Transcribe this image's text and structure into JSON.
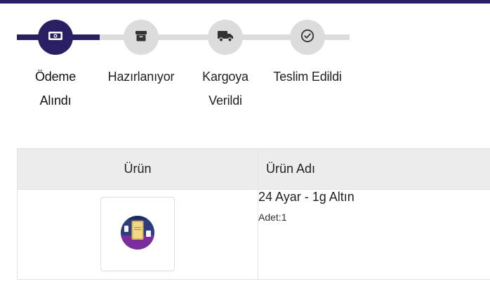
{
  "stepper": {
    "progress_fraction": 0.25,
    "active_color": "#2b1f63",
    "inactive_color": "#dcdcdc",
    "steps": [
      {
        "label_line1": "Ödeme",
        "label_line2": "Alındı",
        "icon": "money-icon",
        "active": true
      },
      {
        "label_line1": "Hazırlanıyor",
        "label_line2": "",
        "icon": "box-icon",
        "active": false
      },
      {
        "label_line1": "Kargoya",
        "label_line2": "Verildi",
        "icon": "truck-icon",
        "active": false
      },
      {
        "label_line1": "Teslim Edildi",
        "label_line2": "",
        "icon": "check-circle-icon",
        "active": false
      }
    ]
  },
  "table": {
    "headers": {
      "product": "Ürün",
      "product_name": "Ürün Adı"
    },
    "rows": [
      {
        "image": "gold-bar-product-image",
        "name": "24 Ayar - 1g Altın",
        "quantity": "Adet:1"
      }
    ]
  }
}
